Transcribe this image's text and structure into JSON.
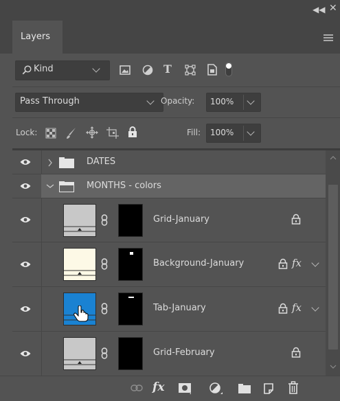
{
  "panel": {
    "tab_label": "Layers"
  },
  "filter": {
    "kind_label": "Kind",
    "icons": [
      "image-filter-icon",
      "adjustment-filter-icon",
      "type-filter-icon",
      "shape-filter-icon",
      "smart-object-filter-icon",
      "filter-toggle-icon"
    ]
  },
  "blend": {
    "mode": "Pass Through",
    "opacity_label": "Opacity:",
    "opacity_value": "100%"
  },
  "lock": {
    "label": "Lock:",
    "fill_label": "Fill:",
    "fill_value": "100%"
  },
  "layers": [
    {
      "name": "DATES",
      "type": "group",
      "expanded": false
    },
    {
      "name": "MONTHS - colors",
      "type": "group",
      "expanded": true,
      "selected": true
    },
    {
      "name": "Grid-January",
      "thumb_color": "#c8c8c8",
      "locked": true,
      "fx": false
    },
    {
      "name": "Background-January",
      "thumb_color": "#fdf9e6",
      "locked": true,
      "fx": true
    },
    {
      "name": "Tab-January",
      "thumb_color": "#1a82d2",
      "locked": true,
      "fx": true
    },
    {
      "name": "Grid-February",
      "thumb_color": "#c8c8c8",
      "locked": true,
      "fx": false
    }
  ],
  "fx_label": "fx",
  "footer": {
    "fx_label": "fx",
    "icons": [
      "link-layers-icon",
      "add-style-icon",
      "add-mask-icon",
      "new-adjustment-icon",
      "new-group-icon",
      "new-layer-icon",
      "delete-layer-icon"
    ]
  },
  "colors": {
    "panel_bg": "#535353",
    "dark_bg": "#454545",
    "selected_row": "#646464",
    "text": "#dcdcdc"
  }
}
